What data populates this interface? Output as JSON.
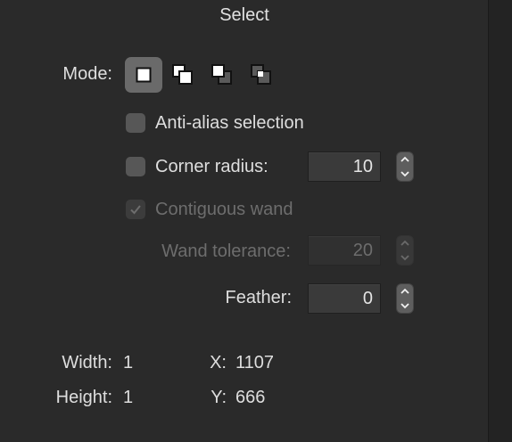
{
  "title": "Select",
  "mode": {
    "label": "Mode:",
    "options": [
      "new-selection",
      "add-to-selection",
      "subtract-from-selection",
      "intersect-with-selection"
    ],
    "selected": "new-selection"
  },
  "anti_alias": {
    "label": "Anti-alias selection",
    "checked": false
  },
  "corner_radius": {
    "label": "Corner radius:",
    "checked": false,
    "value": "10"
  },
  "contiguous_wand": {
    "label": "Contiguous wand",
    "checked": true,
    "enabled": false
  },
  "wand_tolerance": {
    "label": "Wand tolerance:",
    "value": "20",
    "enabled": false
  },
  "feather": {
    "label": "Feather:",
    "value": "0"
  },
  "info": {
    "width_label": "Width:",
    "width_value": "1",
    "height_label": "Height:",
    "height_value": "1",
    "x_label": "X:",
    "x_value": "1107",
    "y_label": "Y:",
    "y_value": "666"
  },
  "colors": {
    "background": "#2a2a2a",
    "selected_mode": "#6a6a6a",
    "text": "#dedede",
    "disabled_text": "#6d6d6d"
  }
}
